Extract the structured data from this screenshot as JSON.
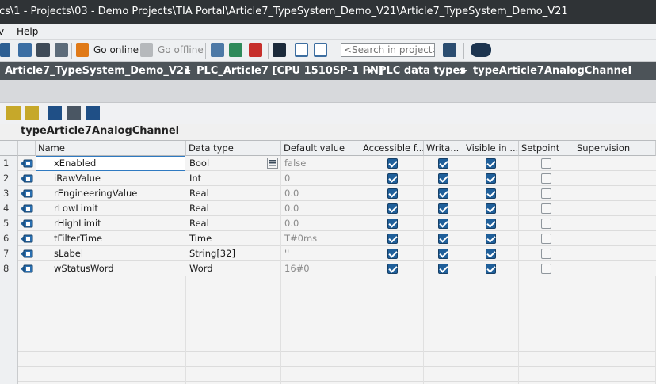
{
  "title": "cs\\1 - Projects\\03 - Demo Projects\\TIA Portal\\Article7_TypeSystem_Demo_V21\\Article7_TypeSystem_Demo_V21",
  "menu": {
    "view": "v",
    "help": "Help"
  },
  "toolbar": {
    "go_online": "Go online",
    "go_offline": "Go offline",
    "search_placeholder": "<Search in project>"
  },
  "breadcrumb": {
    "items": [
      "Article7_TypeSystem_Demo_V21",
      "PLC_Article7 [CPU 1510SP-1 PN]",
      "PLC data types",
      "typeArticle7AnalogChannel"
    ],
    "separator": "▶"
  },
  "block_title": "typeArticle7AnalogChannel",
  "table": {
    "headers": [
      "Name",
      "Data type",
      "Default value",
      "Accessible f...",
      "Writa...",
      "Visible in ...",
      "Setpoint",
      "Supervision"
    ],
    "rows": [
      {
        "num": "1",
        "name": "xEnabled",
        "type": "Bool",
        "default": "false",
        "accessible": true,
        "writable": true,
        "visible": true,
        "setpoint": false
      },
      {
        "num": "2",
        "name": "iRawValue",
        "type": "Int",
        "default": "0",
        "accessible": true,
        "writable": true,
        "visible": true,
        "setpoint": false
      },
      {
        "num": "3",
        "name": "rEngineeringValue",
        "type": "Real",
        "default": "0.0",
        "accessible": true,
        "writable": true,
        "visible": true,
        "setpoint": false
      },
      {
        "num": "4",
        "name": "rLowLimit",
        "type": "Real",
        "default": "0.0",
        "accessible": true,
        "writable": true,
        "visible": true,
        "setpoint": false
      },
      {
        "num": "5",
        "name": "rHighLimit",
        "type": "Real",
        "default": "0.0",
        "accessible": true,
        "writable": true,
        "visible": true,
        "setpoint": false
      },
      {
        "num": "6",
        "name": "tFilterTime",
        "type": "Time",
        "default": "T#0ms",
        "accessible": true,
        "writable": true,
        "visible": true,
        "setpoint": false
      },
      {
        "num": "7",
        "name": "sLabel",
        "type": "String[32]",
        "default": "''",
        "accessible": true,
        "writable": true,
        "visible": true,
        "setpoint": false
      },
      {
        "num": "8",
        "name": "wStatusWord",
        "type": "Word",
        "default": "16#0",
        "accessible": true,
        "writable": true,
        "visible": true,
        "setpoint": false
      }
    ]
  },
  "colors": {
    "titlebar": "#2f3336",
    "breadcrumb": "#4c5358",
    "checkbox_checked": "#1f5f9a",
    "accent": "#2f7ac1"
  }
}
